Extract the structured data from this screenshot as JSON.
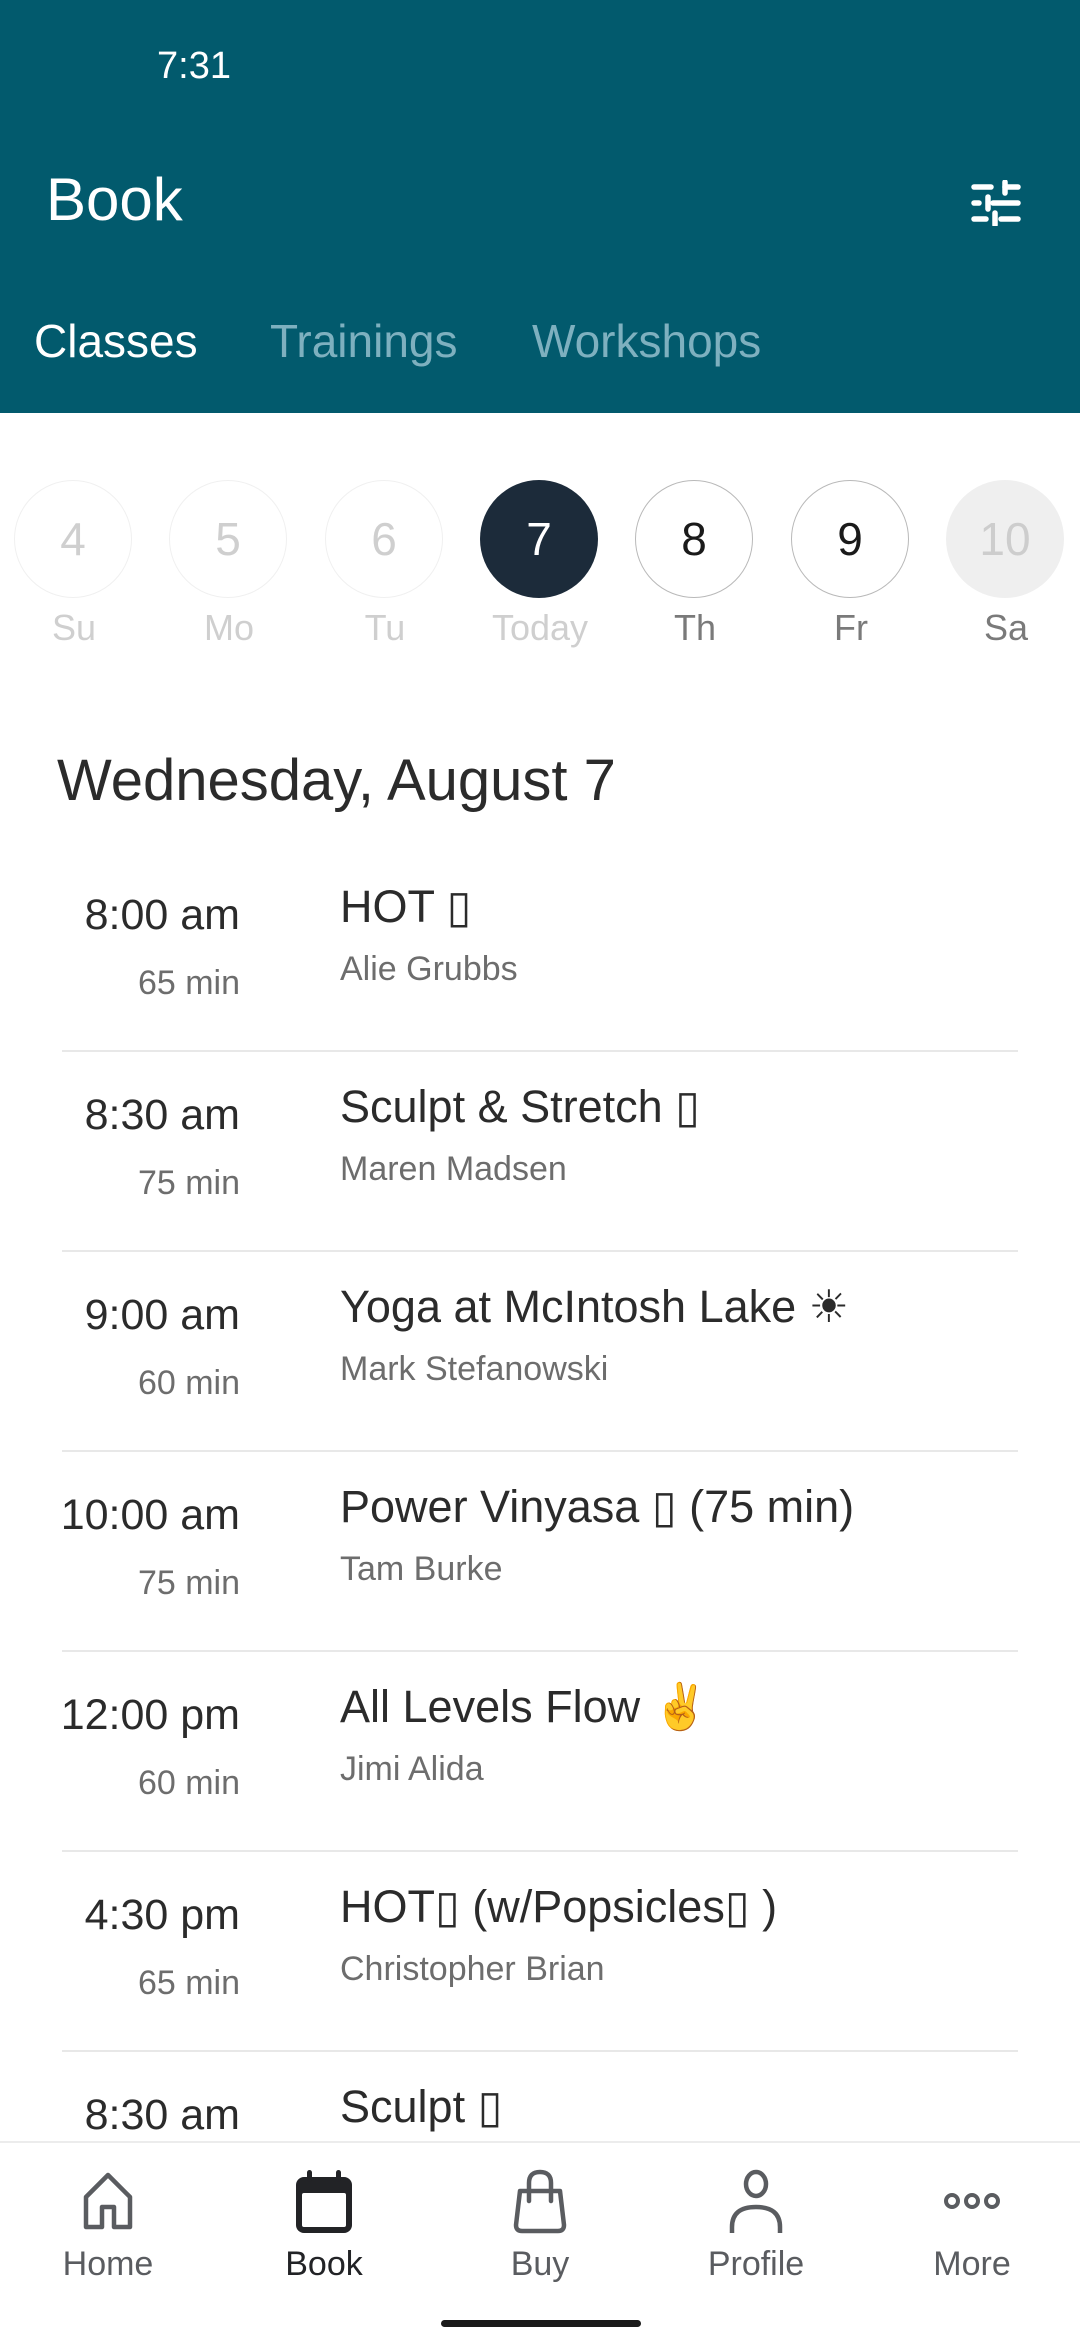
{
  "status_bar": {
    "time": "7:31"
  },
  "header": {
    "title": "Book",
    "filter_icon": "sliders-icon",
    "tabs": [
      {
        "label": "Classes",
        "active": true
      },
      {
        "label": "Trainings",
        "active": false
      },
      {
        "label": "Workshops",
        "active": false
      }
    ]
  },
  "date_strip": {
    "days": [
      {
        "number": "4",
        "label": "Su",
        "state": "past"
      },
      {
        "number": "5",
        "label": "Mo",
        "state": "past"
      },
      {
        "number": "6",
        "label": "Tu",
        "state": "past"
      },
      {
        "number": "7",
        "label": "Today",
        "state": "selected"
      },
      {
        "number": "8",
        "label": "Th",
        "state": "future"
      },
      {
        "number": "9",
        "label": "Fr",
        "state": "future"
      },
      {
        "number": "10",
        "label": "Sa",
        "state": "unavailable"
      }
    ]
  },
  "schedule": {
    "date_heading": "Wednesday, August 7",
    "classes": [
      {
        "time": "8:00 am",
        "duration": "65 min",
        "name": "HOT ▯",
        "instructor": "Alie Grubbs"
      },
      {
        "time": "8:30 am",
        "duration": "75 min",
        "name": "Sculpt & Stretch ▯",
        "instructor": "Maren Madsen"
      },
      {
        "time": "9:00 am",
        "duration": "60 min",
        "name": "Yoga at McIntosh Lake ☀",
        "instructor": "Mark Stefanowski"
      },
      {
        "time": "10:00 am",
        "duration": "75 min",
        "name": "Power Vinyasa ▯ (75 min)",
        "instructor": "Tam Burke"
      },
      {
        "time": "12:00 pm",
        "duration": "60 min",
        "name": "All Levels Flow ✌",
        "instructor": "Jimi Alida"
      },
      {
        "time": "4:30 pm",
        "duration": "65 min",
        "name": "HOT▯ (w/Popsicles▯ )",
        "instructor": "Christopher Brian"
      },
      {
        "time": "8:30 am",
        "duration": "",
        "name": "Sculpt ▯",
        "instructor": ""
      }
    ]
  },
  "bottom_nav": {
    "items": [
      {
        "label": "Home",
        "icon": "home-icon",
        "active": false
      },
      {
        "label": "Book",
        "icon": "calendar-icon",
        "active": true
      },
      {
        "label": "Buy",
        "icon": "shopping-bag-icon",
        "active": false
      },
      {
        "label": "Profile",
        "icon": "person-icon",
        "active": false
      },
      {
        "label": "More",
        "icon": "more-dots-icon",
        "active": false
      }
    ]
  },
  "colors": {
    "header_bg": "#025a6d",
    "tab_inactive": "#7eb0bf",
    "selected_day_bg": "#1c2b3a"
  }
}
